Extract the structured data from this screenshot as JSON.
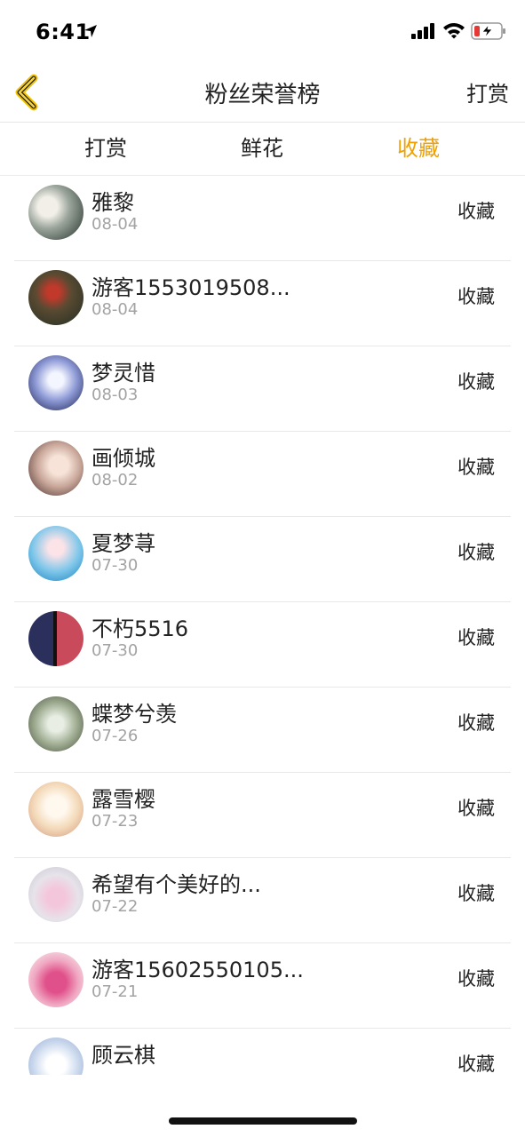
{
  "status": {
    "time": "6:41"
  },
  "nav": {
    "title": "粉丝荣誉榜",
    "right_label": "打赏"
  },
  "tabs": [
    {
      "label": "打赏",
      "active": false
    },
    {
      "label": "鲜花",
      "active": false
    },
    {
      "label": "收藏",
      "active": true
    }
  ],
  "colors": {
    "accent": "#f0a100",
    "divider": "#e8e8e8",
    "subtext": "#a3a3a3"
  },
  "fans": [
    {
      "name": "雅黎",
      "date": "08-04",
      "action": "收藏"
    },
    {
      "name": "游客1553019508...",
      "date": "08-04",
      "action": "收藏"
    },
    {
      "name": "梦灵惜",
      "date": "08-03",
      "action": "收藏"
    },
    {
      "name": "画倾城",
      "date": "08-02",
      "action": "收藏"
    },
    {
      "name": "夏梦荨",
      "date": "07-30",
      "action": "收藏"
    },
    {
      "name": "不朽5516",
      "date": "07-30",
      "action": "收藏"
    },
    {
      "name": "蝶梦兮羡",
      "date": "07-26",
      "action": "收藏"
    },
    {
      "name": "露雪樱",
      "date": "07-23",
      "action": "收藏"
    },
    {
      "name": "希望有个美好的...",
      "date": "07-22",
      "action": "收藏"
    },
    {
      "name": "游客15602550105...",
      "date": "07-21",
      "action": "收藏"
    },
    {
      "name": "顾云棋",
      "date": "",
      "action": "收藏"
    }
  ]
}
